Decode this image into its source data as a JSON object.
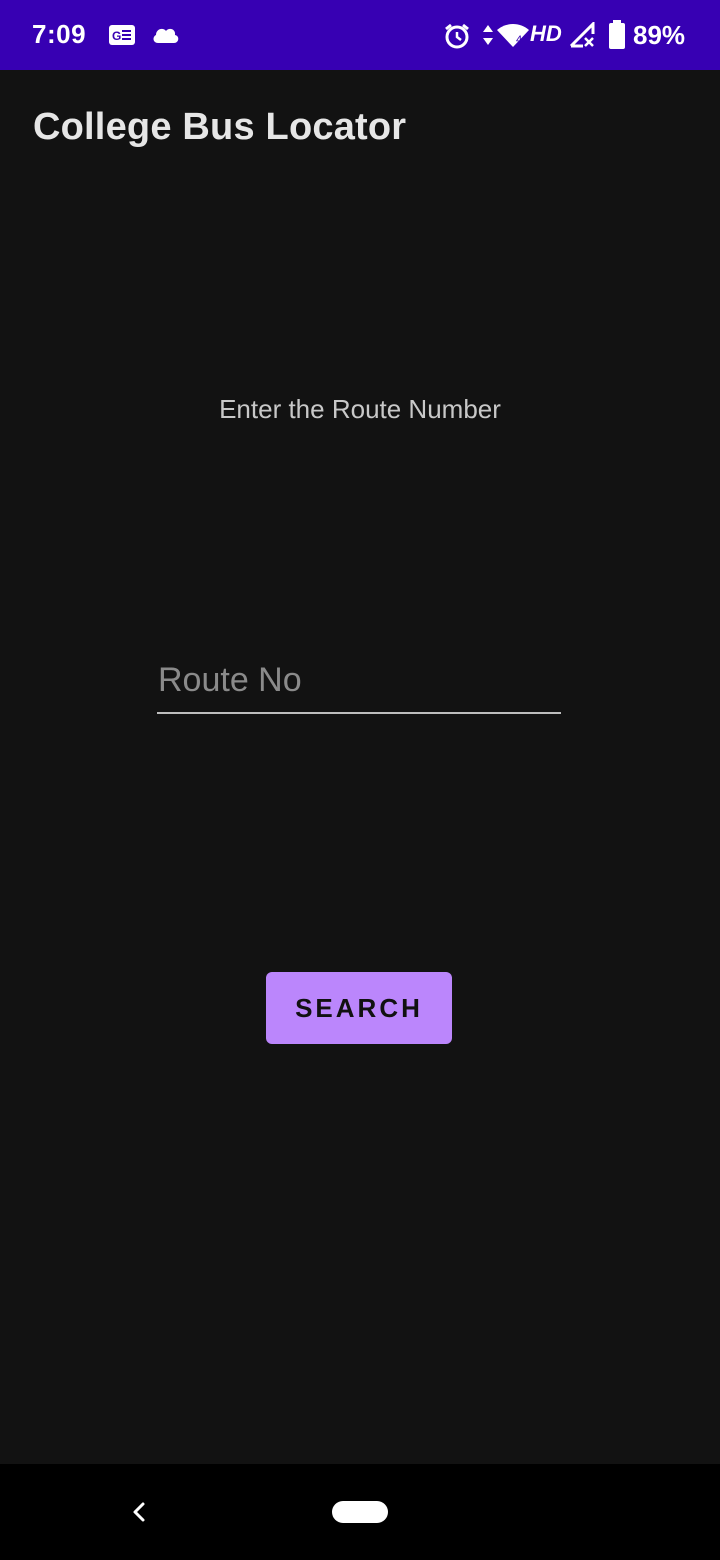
{
  "status_bar": {
    "time": "7:09",
    "network_label": "HD",
    "battery": "89%",
    "background_color": "#3700b3",
    "icons": [
      "gmail-icon",
      "cloud-icon",
      "alarm-icon",
      "data-arrows-icon",
      "wifi-icon",
      "signal-icon",
      "battery-icon"
    ]
  },
  "app_bar": {
    "title": "College Bus Locator"
  },
  "main": {
    "prompt": "Enter the Route Number",
    "route_input": {
      "value": "",
      "placeholder": "Route No"
    },
    "search_button_label": "SEARCH",
    "accent_color": "#bb86fc"
  },
  "nav_bar": {
    "icons": [
      "back-icon",
      "home-pill-icon"
    ]
  }
}
